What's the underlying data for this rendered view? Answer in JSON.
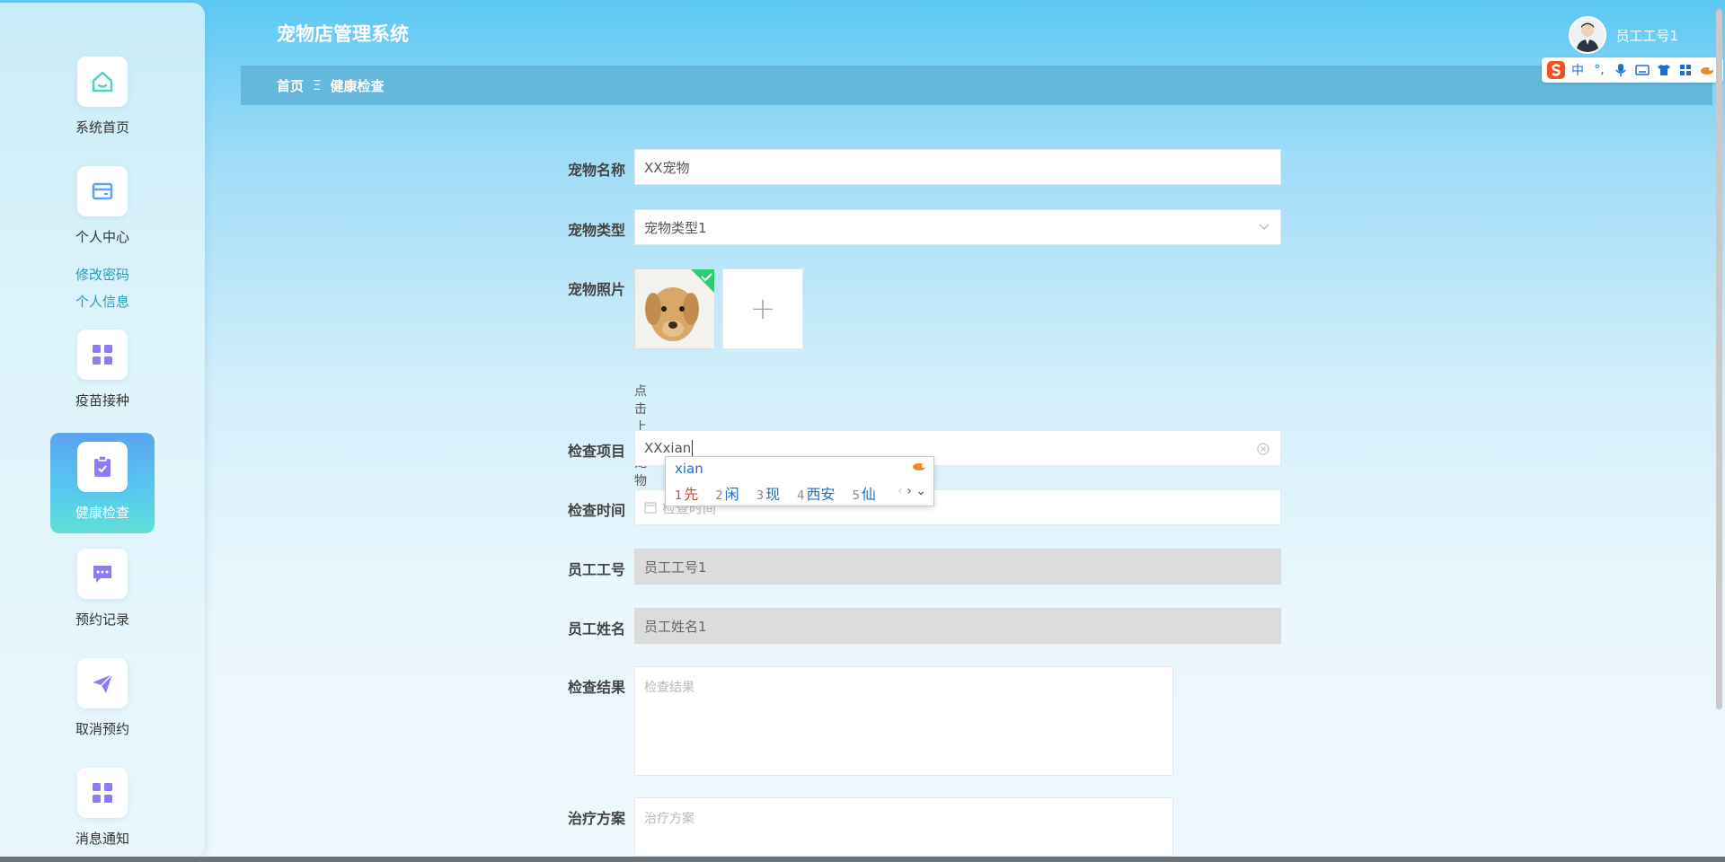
{
  "app": {
    "title": "宠物店管理系统"
  },
  "user": {
    "name": "员工工号1"
  },
  "breadcrumb": {
    "home": "首页",
    "separator": "Ξ",
    "current": "健康检查"
  },
  "sidebar": {
    "items": [
      {
        "label": "系统首页",
        "icon": "home-icon"
      },
      {
        "label": "个人中心",
        "icon": "card-icon"
      },
      {
        "label": "疫苗接种",
        "icon": "grid-icon"
      },
      {
        "label": "健康检查",
        "icon": "clipboard-icon"
      },
      {
        "label": "预约记录",
        "icon": "chat-icon"
      },
      {
        "label": "取消预约",
        "icon": "send-icon"
      },
      {
        "label": "消息通知",
        "icon": "grid-icon"
      }
    ],
    "sub_links": [
      "修改密码",
      "个人信息"
    ]
  },
  "form": {
    "pet_name": {
      "label": "宠物名称",
      "value": "XX宠物"
    },
    "pet_type": {
      "label": "宠物类型",
      "value": "宠物类型1"
    },
    "pet_photo": {
      "label": "宠物照片",
      "hint": "点击上传宠物照片",
      "add_symbol": "+"
    },
    "check_item": {
      "label": "检查项目",
      "value": "XXxian"
    },
    "check_time": {
      "label": "检查时间",
      "placeholder": "检查时间"
    },
    "employee_id": {
      "label": "员工工号",
      "value": "员工工号1"
    },
    "employee_name": {
      "label": "员工姓名",
      "value": "员工姓名1"
    },
    "check_result": {
      "label": "检查结果",
      "placeholder": "检查结果"
    },
    "treatment": {
      "label": "治疗方案",
      "placeholder": "治疗方案"
    }
  },
  "ime": {
    "composition": "xian",
    "candidates": [
      {
        "num": "1",
        "text": "先"
      },
      {
        "num": "2",
        "text": "闲"
      },
      {
        "num": "3",
        "text": "现"
      },
      {
        "num": "4",
        "text": "西安"
      },
      {
        "num": "5",
        "text": "仙"
      }
    ],
    "toolbar": {
      "mode": "中"
    }
  },
  "colors": {
    "accent": "#5aa4f2",
    "breadcrumb_bg": "#63b8dc",
    "link": "#2a9bb5"
  }
}
